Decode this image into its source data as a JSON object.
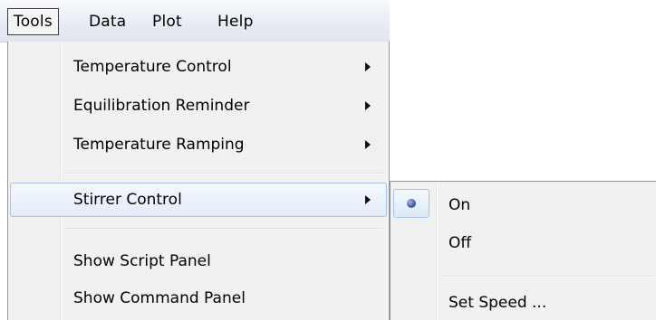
{
  "menubar": {
    "items": [
      {
        "label": "Tools",
        "active": true
      },
      {
        "label": "Data"
      },
      {
        "label": "Plot"
      },
      {
        "label": "Help"
      }
    ]
  },
  "tools_menu": {
    "items": [
      {
        "label": "Temperature Control",
        "has_submenu": true
      },
      {
        "label": "Equilibration Reminder",
        "has_submenu": true
      },
      {
        "label": "Temperature Ramping",
        "has_submenu": true
      },
      {
        "label": "Stirrer Control",
        "has_submenu": true,
        "highlighted": true
      },
      {
        "label": "Show Script Panel",
        "has_submenu": false
      },
      {
        "label": "Show Command Panel",
        "has_submenu": false
      }
    ]
  },
  "stirrer_submenu": {
    "items": [
      {
        "label": "On",
        "selected": true
      },
      {
        "label": "Off",
        "selected": false
      },
      {
        "label": "Set Speed ...",
        "selected": false
      }
    ]
  },
  "colors": {
    "menubar_bg": "#e7ebf3",
    "menu_bg": "#f1f1f1",
    "highlight_border": "#a8c3e6",
    "radio_dot": "#4a5fb0"
  }
}
